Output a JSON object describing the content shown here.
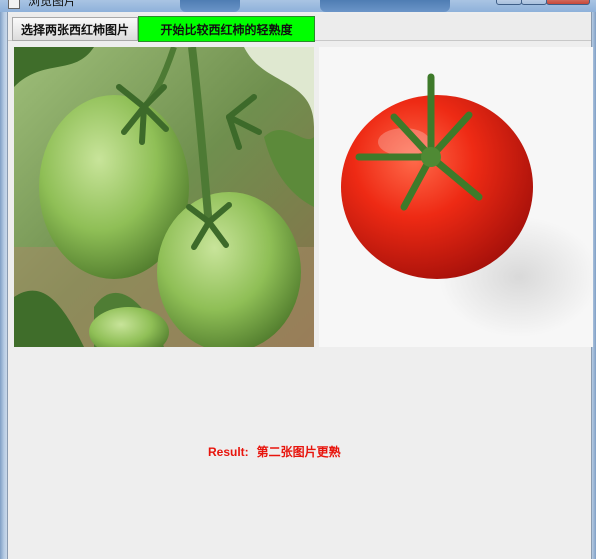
{
  "window": {
    "title": "浏览图片"
  },
  "toolbar": {
    "select_label": "选择两张西红柿图片",
    "compare_label": "开始比较西红柿的轻熟度"
  },
  "images": {
    "left": {
      "name": "green-tomatoes-image"
    },
    "right": {
      "name": "red-tomato-image"
    }
  },
  "result": {
    "label": "Result:",
    "value": "第二张图片更熟"
  },
  "colors": {
    "compare_button": "#00ff00",
    "result_text": "#e8140c",
    "panel_bg": "#eeeeee"
  }
}
